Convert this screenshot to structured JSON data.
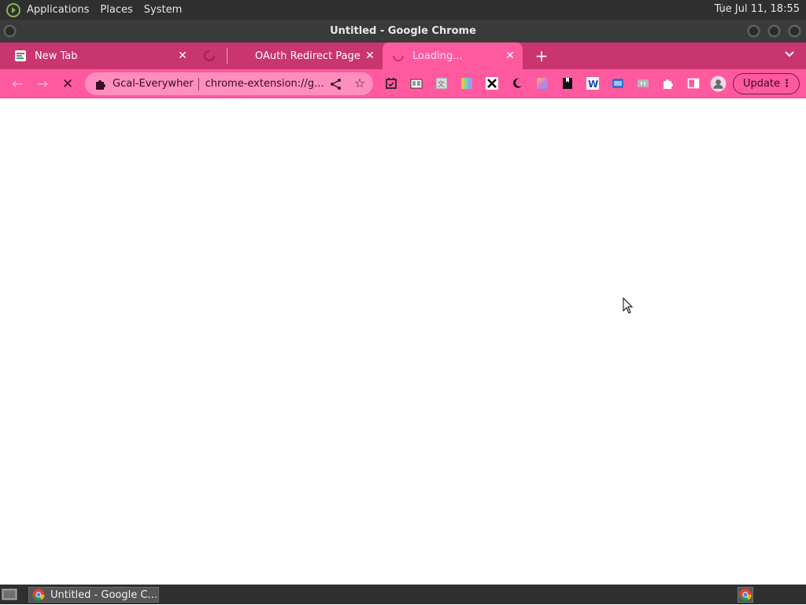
{
  "top_panel": {
    "menus": [
      "Applications",
      "Places",
      "System"
    ],
    "clock": "Tue Jul 11, 18:55"
  },
  "window": {
    "title": "Untitled - Google Chrome"
  },
  "tabs": [
    {
      "label": "New Tab",
      "state": "inactive"
    },
    {
      "label": "OAuth Redirect Page",
      "state": "inactive",
      "loading_favicon": true
    },
    {
      "label": "Loading...",
      "state": "active",
      "loading_favicon": true
    }
  ],
  "toolbar": {
    "site_name": "Gcal-Everywher",
    "url": "chrome-extension://g...",
    "update_label": "Update",
    "extensions": [
      "calendar-icon",
      "reader-icon",
      "translate-icon",
      "color-icon",
      "x-icon",
      "moon-icon",
      "gradient-icon",
      "bookmark-icon",
      "word-icon",
      "screenshot-icon",
      "chat-icon",
      "puzzle-icon",
      "sidepanel-icon",
      "profile-icon"
    ]
  },
  "taskbar": {
    "window_button": "Untitled - Google C..."
  },
  "colors": {
    "tabstrip": "#c9356e",
    "toolbar": "#ff5aa0",
    "panel": "#2f2f2f"
  }
}
